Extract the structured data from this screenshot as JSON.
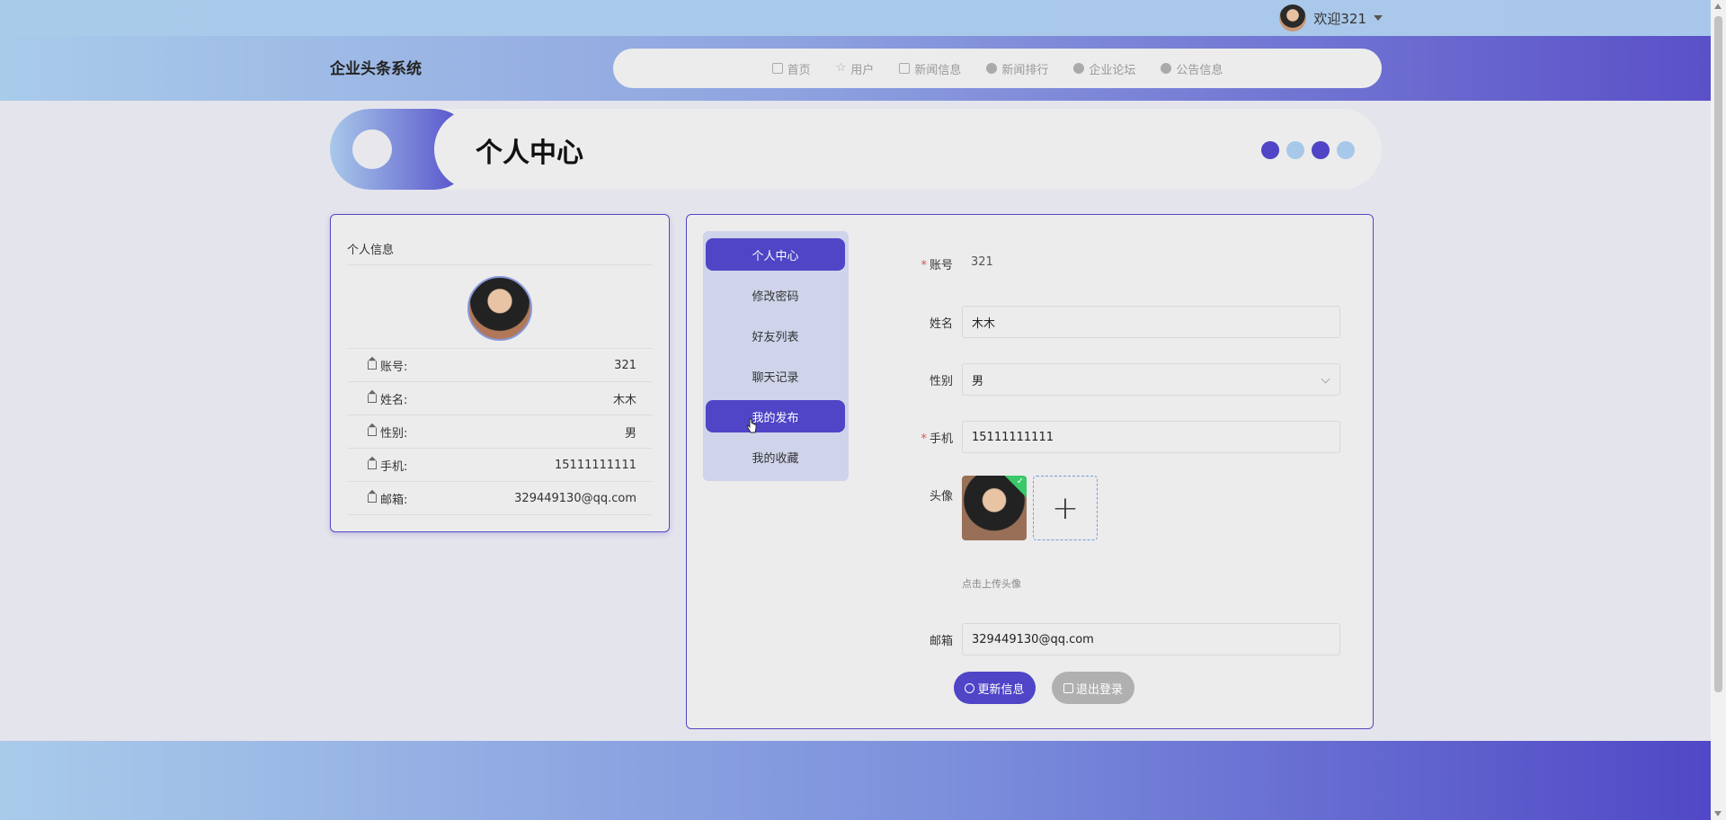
{
  "topbar": {
    "welcome": "欢迎321"
  },
  "brand": "企业头条系统",
  "nav": [
    {
      "label": "首页",
      "icon": "home-icon"
    },
    {
      "label": "用户",
      "icon": "star-icon"
    },
    {
      "label": "新闻信息",
      "icon": "bag-icon"
    },
    {
      "label": "新闻排行",
      "icon": "info-icon"
    },
    {
      "label": "企业论坛",
      "icon": "info-icon"
    },
    {
      "label": "公告信息",
      "icon": "info-icon"
    }
  ],
  "banner": {
    "title": "个人中心",
    "dot_colors": [
      "#4f45c6",
      "#a8c8ea",
      "#4f45c6",
      "#a8c8ea"
    ]
  },
  "profile_card": {
    "title": "个人信息",
    "rows": [
      {
        "label": "账号:",
        "value": "321"
      },
      {
        "label": "姓名:",
        "value": "木木"
      },
      {
        "label": "性别:",
        "value": "男"
      },
      {
        "label": "手机:",
        "value": "15111111111"
      },
      {
        "label": "邮箱:",
        "value": "329449130@qq.com"
      }
    ]
  },
  "menu": [
    {
      "label": "个人中心",
      "active": true
    },
    {
      "label": "修改密码",
      "active": false
    },
    {
      "label": "好友列表",
      "active": false
    },
    {
      "label": "聊天记录",
      "active": false
    },
    {
      "label": "我的发布",
      "active": true
    },
    {
      "label": "我的收藏",
      "active": false
    }
  ],
  "form": {
    "account_label": "账号",
    "account_value": "321",
    "name_label": "姓名",
    "name_value": "木木",
    "gender_label": "性别",
    "gender_value": "男",
    "phone_label": "手机",
    "phone_value": "15111111111",
    "avatar_label": "头像",
    "avatar_tip": "点击上传头像",
    "email_label": "邮箱",
    "email_value": "329449130@qq.com",
    "update_button": "更新信息",
    "logout_button": "退出登录"
  },
  "colors": {
    "accent": "#4f45c6",
    "light_blue": "#a8c8ea",
    "required": "#e05050",
    "success": "#39c86a"
  }
}
